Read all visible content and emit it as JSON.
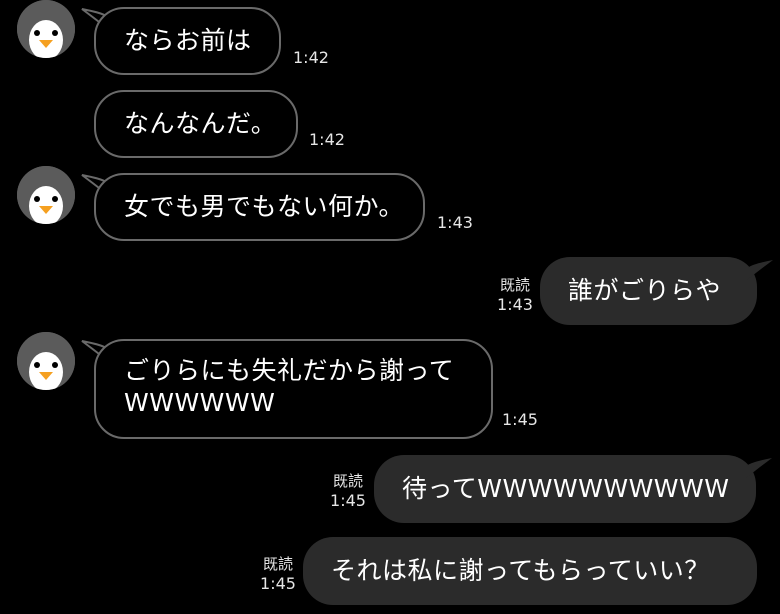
{
  "messages": [
    {
      "side": "in",
      "text": "ならお前は",
      "time": "1:42",
      "avatar": "penguin-avatar"
    },
    {
      "side": "in",
      "text": "なんなんだ。",
      "time": "1:42"
    },
    {
      "side": "in",
      "text": "女でも男でもない何か。",
      "time": "1:43",
      "avatar": "penguin-avatar"
    },
    {
      "side": "out",
      "text": "誰がごりらや",
      "read": "既読",
      "time": "1:43"
    },
    {
      "side": "in",
      "text": "ごりらにも失礼だから謝って\nWWWWWW",
      "time": "1:45",
      "avatar": "penguin-avatar"
    },
    {
      "side": "out",
      "text": "待ってWWWWWWWWWW",
      "read": "既読",
      "time": "1:45"
    },
    {
      "side": "out",
      "text": "それは私に謝ってもらっていい？",
      "read": "既読",
      "time": "1:45"
    }
  ],
  "colors": {
    "background": "#000000",
    "incoming_border": "#6a6a6a",
    "outgoing_fill": "#2b2b2b",
    "avatar_bg": "#5b5b5b",
    "penguin_beak": "#f5a020"
  }
}
